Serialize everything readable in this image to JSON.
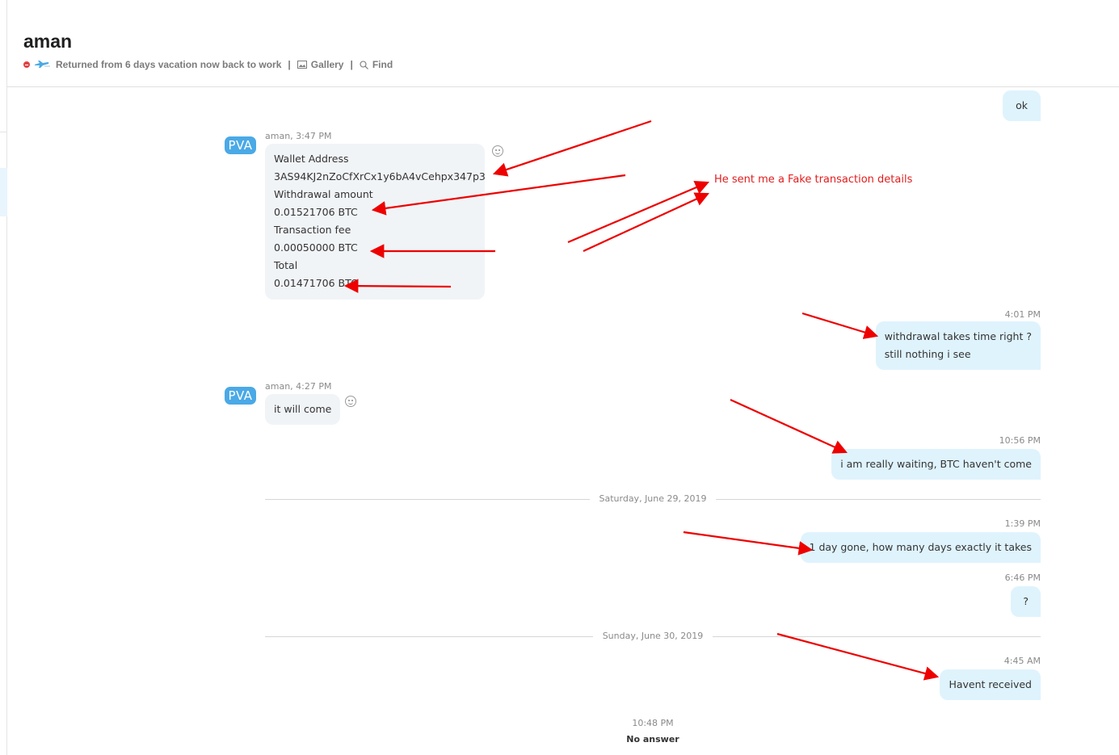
{
  "header": {
    "title": "aman",
    "mood": "Returned from 6 days vacation now back to work",
    "gallery_label": "Gallery",
    "find_label": "Find",
    "separator": "|"
  },
  "messages": {
    "ok_out": {
      "text": "ok"
    },
    "wallet_in": {
      "avatar": "PVA",
      "meta": "aman, 3:47 PM",
      "lines": [
        "Wallet Address",
        "3AS94KJ2nZoCfXrCx1y6bA4vCehpx347p3",
        "Withdrawal amount",
        "0.01521706 BTC",
        "Transaction fee",
        "0.00050000 BTC",
        "Total",
        "0.01471706 BTC"
      ]
    },
    "withdraw_out": {
      "time": "4:01 PM",
      "lines": [
        "withdrawal takes time right ?",
        "still nothing i see"
      ]
    },
    "come_in": {
      "avatar": "PVA",
      "meta": "aman, 4:27 PM",
      "text": "it will come"
    },
    "waiting_out": {
      "time": "10:56 PM",
      "text": "i am really waiting, BTC haven't come"
    },
    "day1": "Saturday, June 29, 2019",
    "gone_out": {
      "time": "1:39 PM",
      "text": "1 day gone, how many days exactly it takes"
    },
    "q_out": {
      "time": "6:46 PM",
      "text": "?"
    },
    "day2": "Sunday, June 30, 2019",
    "recv_out": {
      "time": "4:45 AM",
      "text": "Havent received"
    },
    "call": {
      "time": "10:48 PM",
      "status": "No answer"
    }
  },
  "annotation": {
    "text": "He sent me a Fake transaction details",
    "color": "#e21c1c"
  },
  "colors": {
    "outgoing_bubble": "#dff3fd",
    "incoming_bubble": "#f1f4f7",
    "avatar": "#4aa9e6",
    "arrow": "#ee0000"
  }
}
